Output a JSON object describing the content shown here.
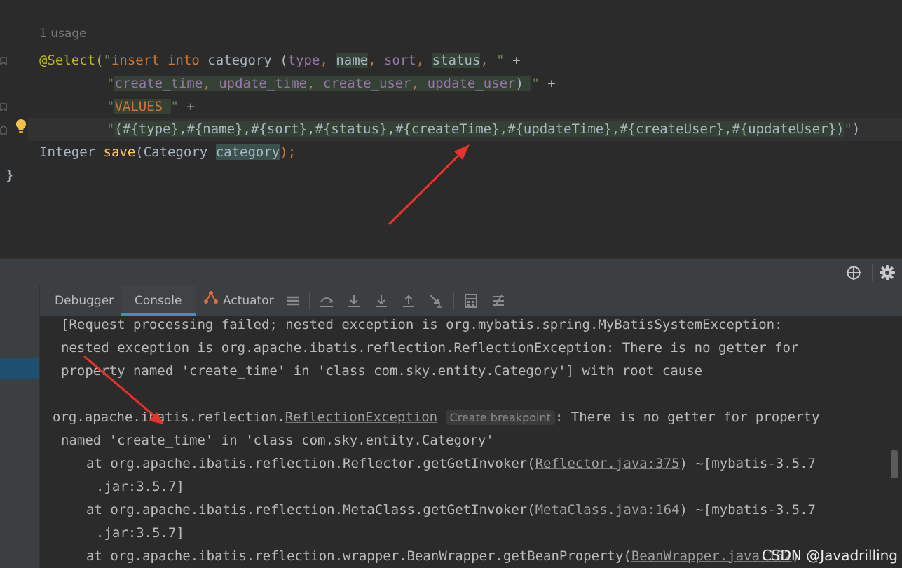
{
  "editor": {
    "usage_hint": "1 usage",
    "lines": {
      "l1": {
        "annotation": "@Select(",
        "q": "\"",
        "kw_insert": "insert",
        "sp1": " ",
        "kw_into": "into",
        "t1": " category (",
        "p_type": "type",
        "c1": ", ",
        "name": "name",
        "c2": ", ",
        "p_sort": "sort",
        "c3": ", ",
        "status": "status",
        "c4": ", ",
        "endq": "\"",
        "plus": " +"
      },
      "l2": {
        "q": "\"",
        "p_ct": "create_time",
        "c1": ", ",
        "p_ut": "update_time",
        "c2": ", ",
        "p_cu": "create_user",
        "c3": ", ",
        "p_uu": "update_user",
        "t1": ") ",
        "endq": "\"",
        "plus": " +"
      },
      "l3": {
        "q": "\"",
        "kw_values": "VALUES",
        "t1": " ",
        "endq": "\"",
        "plus": " +"
      },
      "l4": {
        "q": "\"",
        "text": "(#{type},#{name},#{sort},#{status},#{createTime},#{updateTime},#{createUser},#{updateUser})",
        "endq": "\"",
        "close": ")"
      },
      "l5": {
        "type": "Integer ",
        "fn": "save",
        "open": "(",
        "param_type": "Category ",
        "param": "category",
        "close": ");"
      },
      "l6": {
        "brace": "}"
      }
    }
  },
  "toolwindow": {
    "tabs": {
      "debugger": "Debugger",
      "console": "Console",
      "actuator": "Actuator"
    },
    "console": {
      "line1": "[Request processing failed; nested exception is org.mybatis.spring.MyBatisSystemException:",
      "line2": "nested exception is org.apache.ibatis.reflection.ReflectionException: There is no getter for",
      "line3": "property named 'create_time' in 'class com.sky.entity.Category'] with root cause",
      "line5_pre": "org.apache.ibatis.reflection.",
      "line5_link": "ReflectionException",
      "line5_chip": "Create breakpoint",
      "line5_post": ": There is no getter for property",
      "line6": "named 'create_time' in 'class com.sky.entity.Category'",
      "line7_pre": "at org.apache.ibatis.reflection.Reflector.getGetInvoker(",
      "line7_link": "Reflector.java:375",
      "line7_post": ") ~[mybatis-3.5.7",
      "line8": ".jar:3.5.7]",
      "line9_pre": "at org.apache.ibatis.reflection.MetaClass.getGetInvoker(",
      "line9_link": "MetaClass.java:164",
      "line9_post": ") ~[mybatis-3.5.7",
      "line10": ".jar:3.5.7]",
      "line11_pre": "at org.apache.ibatis.reflection.wrapper.BeanWrapper.getBeanProperty(",
      "line11_link": "BeanWrapper.java:162",
      "line11_post": ")"
    }
  },
  "watermark": "CSDN @Javadrilling",
  "colors": {
    "annotation_arrow": "#e8332a",
    "accent": "#4a88c7"
  }
}
